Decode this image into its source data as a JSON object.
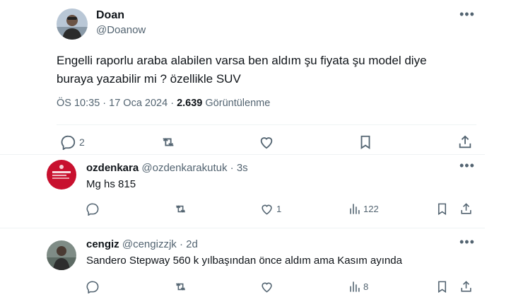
{
  "main_tweet": {
    "author_name": "Doan",
    "author_handle": "@Doanow",
    "text_line1": "Engelli raporlu araba alabilen varsa ben aldım şu fiyata şu model diye",
    "text_line2": "buraya yazabilir mi ? özellikle SUV",
    "timestamp": "ÖS 10:35 · 17 Oca 2024 · ",
    "views_count": "2.639",
    "views_label": " Görüntülenme",
    "more_icon": "•••",
    "actions": {
      "reply_count": "2"
    }
  },
  "replies": [
    {
      "name": "ozdenkara",
      "handle": "@ozdenkarakutuk · 3s",
      "text": "Mg hs 815",
      "more_icon": "•••",
      "like_count": "1",
      "view_count": "122"
    },
    {
      "name": "cengiz",
      "handle": "@cengizzjk · 2d",
      "text": "Sandero Stepway 560 k yılbaşından önce aldım ama Kasım ayında",
      "more_icon": "•••",
      "like_count": "",
      "view_count": "8"
    }
  ],
  "colors": {
    "text_primary": "#0f1419",
    "text_secondary": "#536471",
    "divider": "#eff3f4",
    "avatar_red": "#c8102e"
  }
}
